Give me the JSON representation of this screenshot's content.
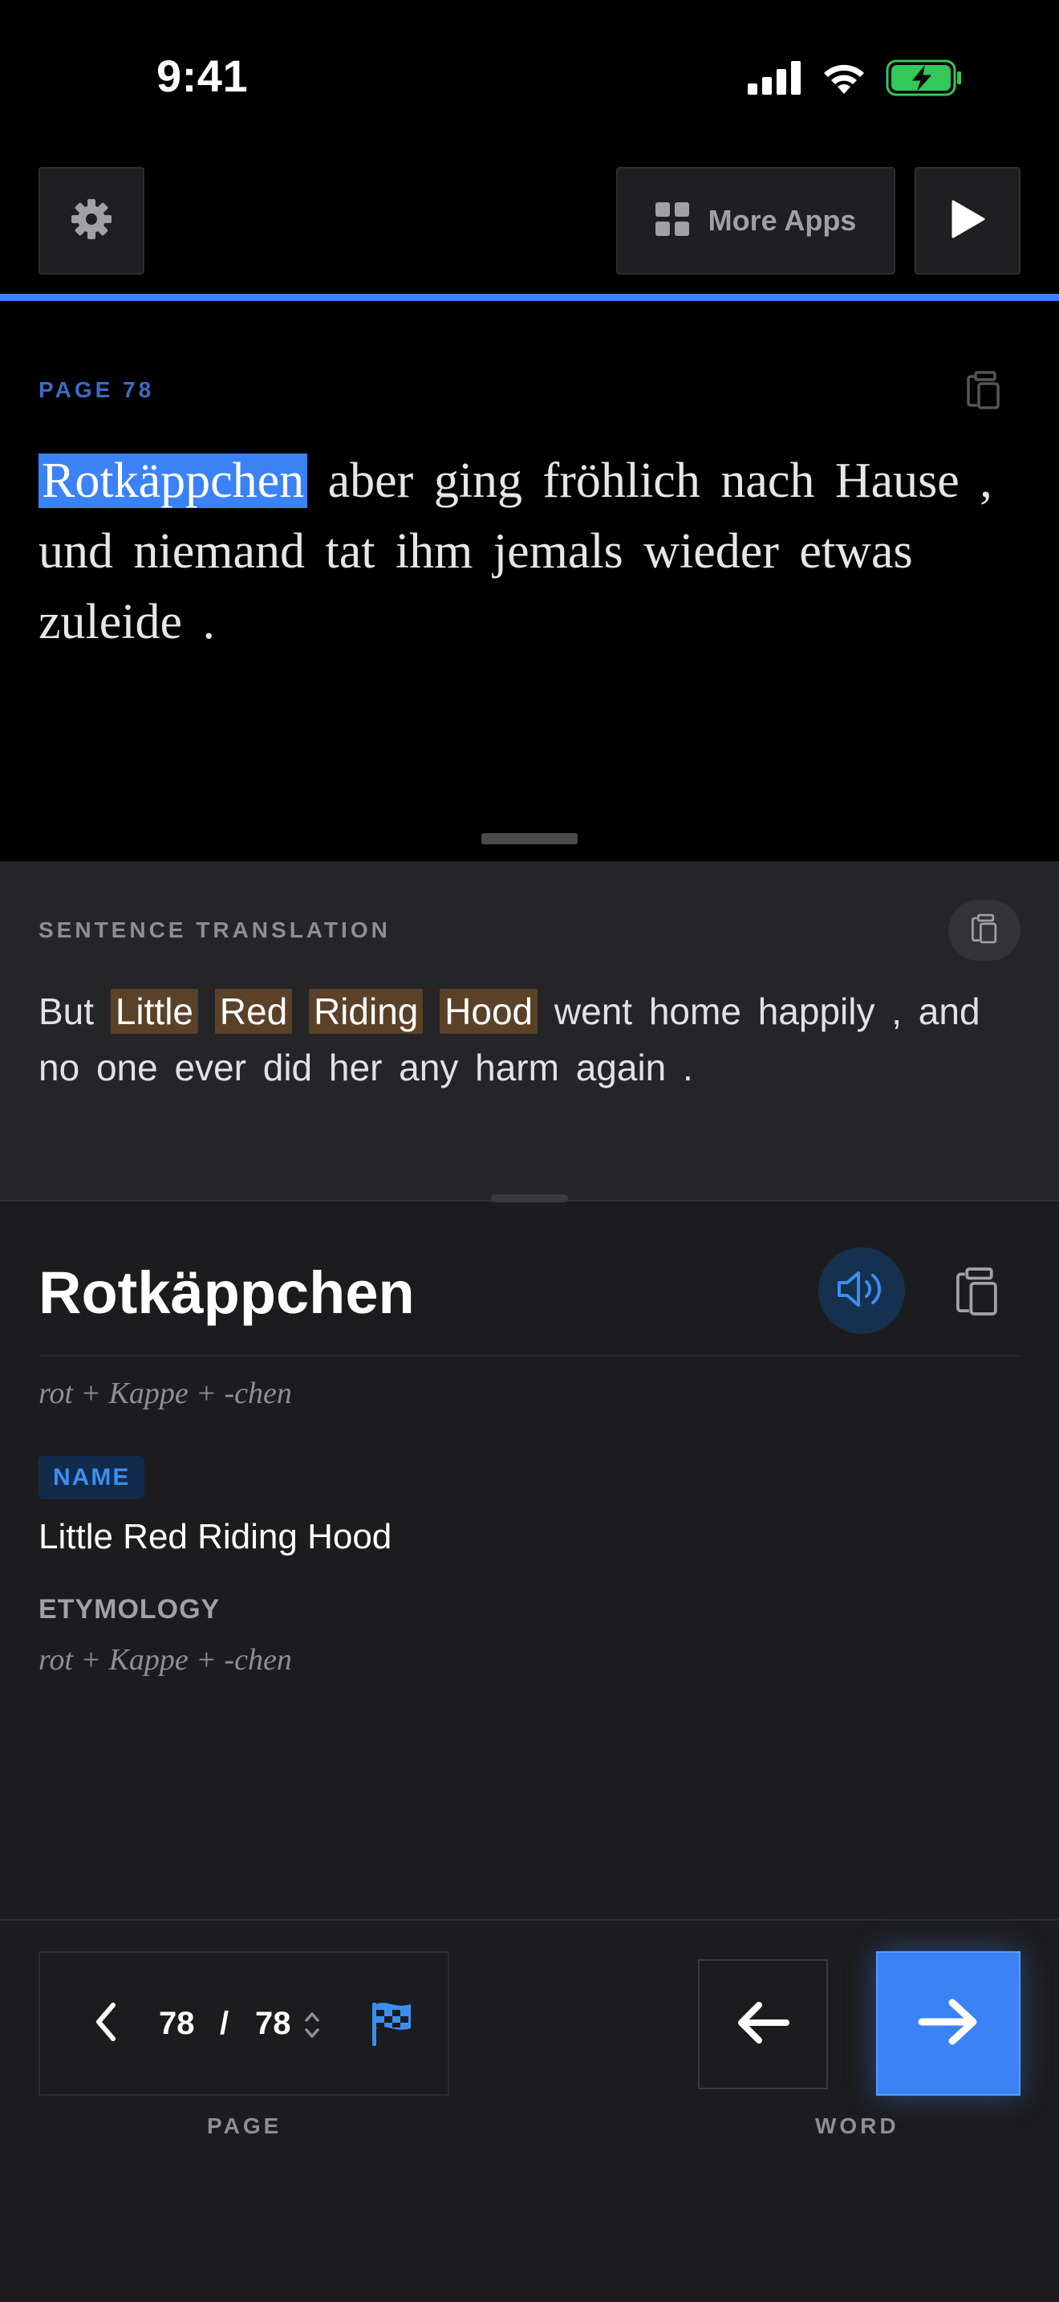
{
  "status_bar": {
    "time": "9:41"
  },
  "toolbar": {
    "more_apps_label": "More Apps"
  },
  "reader": {
    "page_label": "PAGE  78",
    "highlighted_word": "Rotkäppchen",
    "sentence_rest": " aber ging fröhlich nach Hause , und niemand tat ihm jemals wieder etwas zuleide ."
  },
  "translation": {
    "label": "SENTENCE TRANSLATION",
    "before": "But ",
    "highlighted_words": [
      "Little",
      "Red",
      "Riding",
      "Hood"
    ],
    "after": " went home happily , and no one ever did her any harm again ."
  },
  "word": {
    "headword": "Rotkäppchen",
    "morphology": "rot + Kappe + -chen",
    "badge": "NAME",
    "meaning": "Little Red Riding Hood",
    "etymology_label": "ETYMOLOGY",
    "etymology": "rot + Kappe + -chen"
  },
  "bottom": {
    "current_page": "78",
    "separator": "/",
    "total_pages": "78",
    "page_caption": "PAGE",
    "word_caption": "WORD"
  },
  "colors": {
    "accent": "#3b82f6",
    "highlight_translation": "#5a4128",
    "battery": "#34c759"
  }
}
